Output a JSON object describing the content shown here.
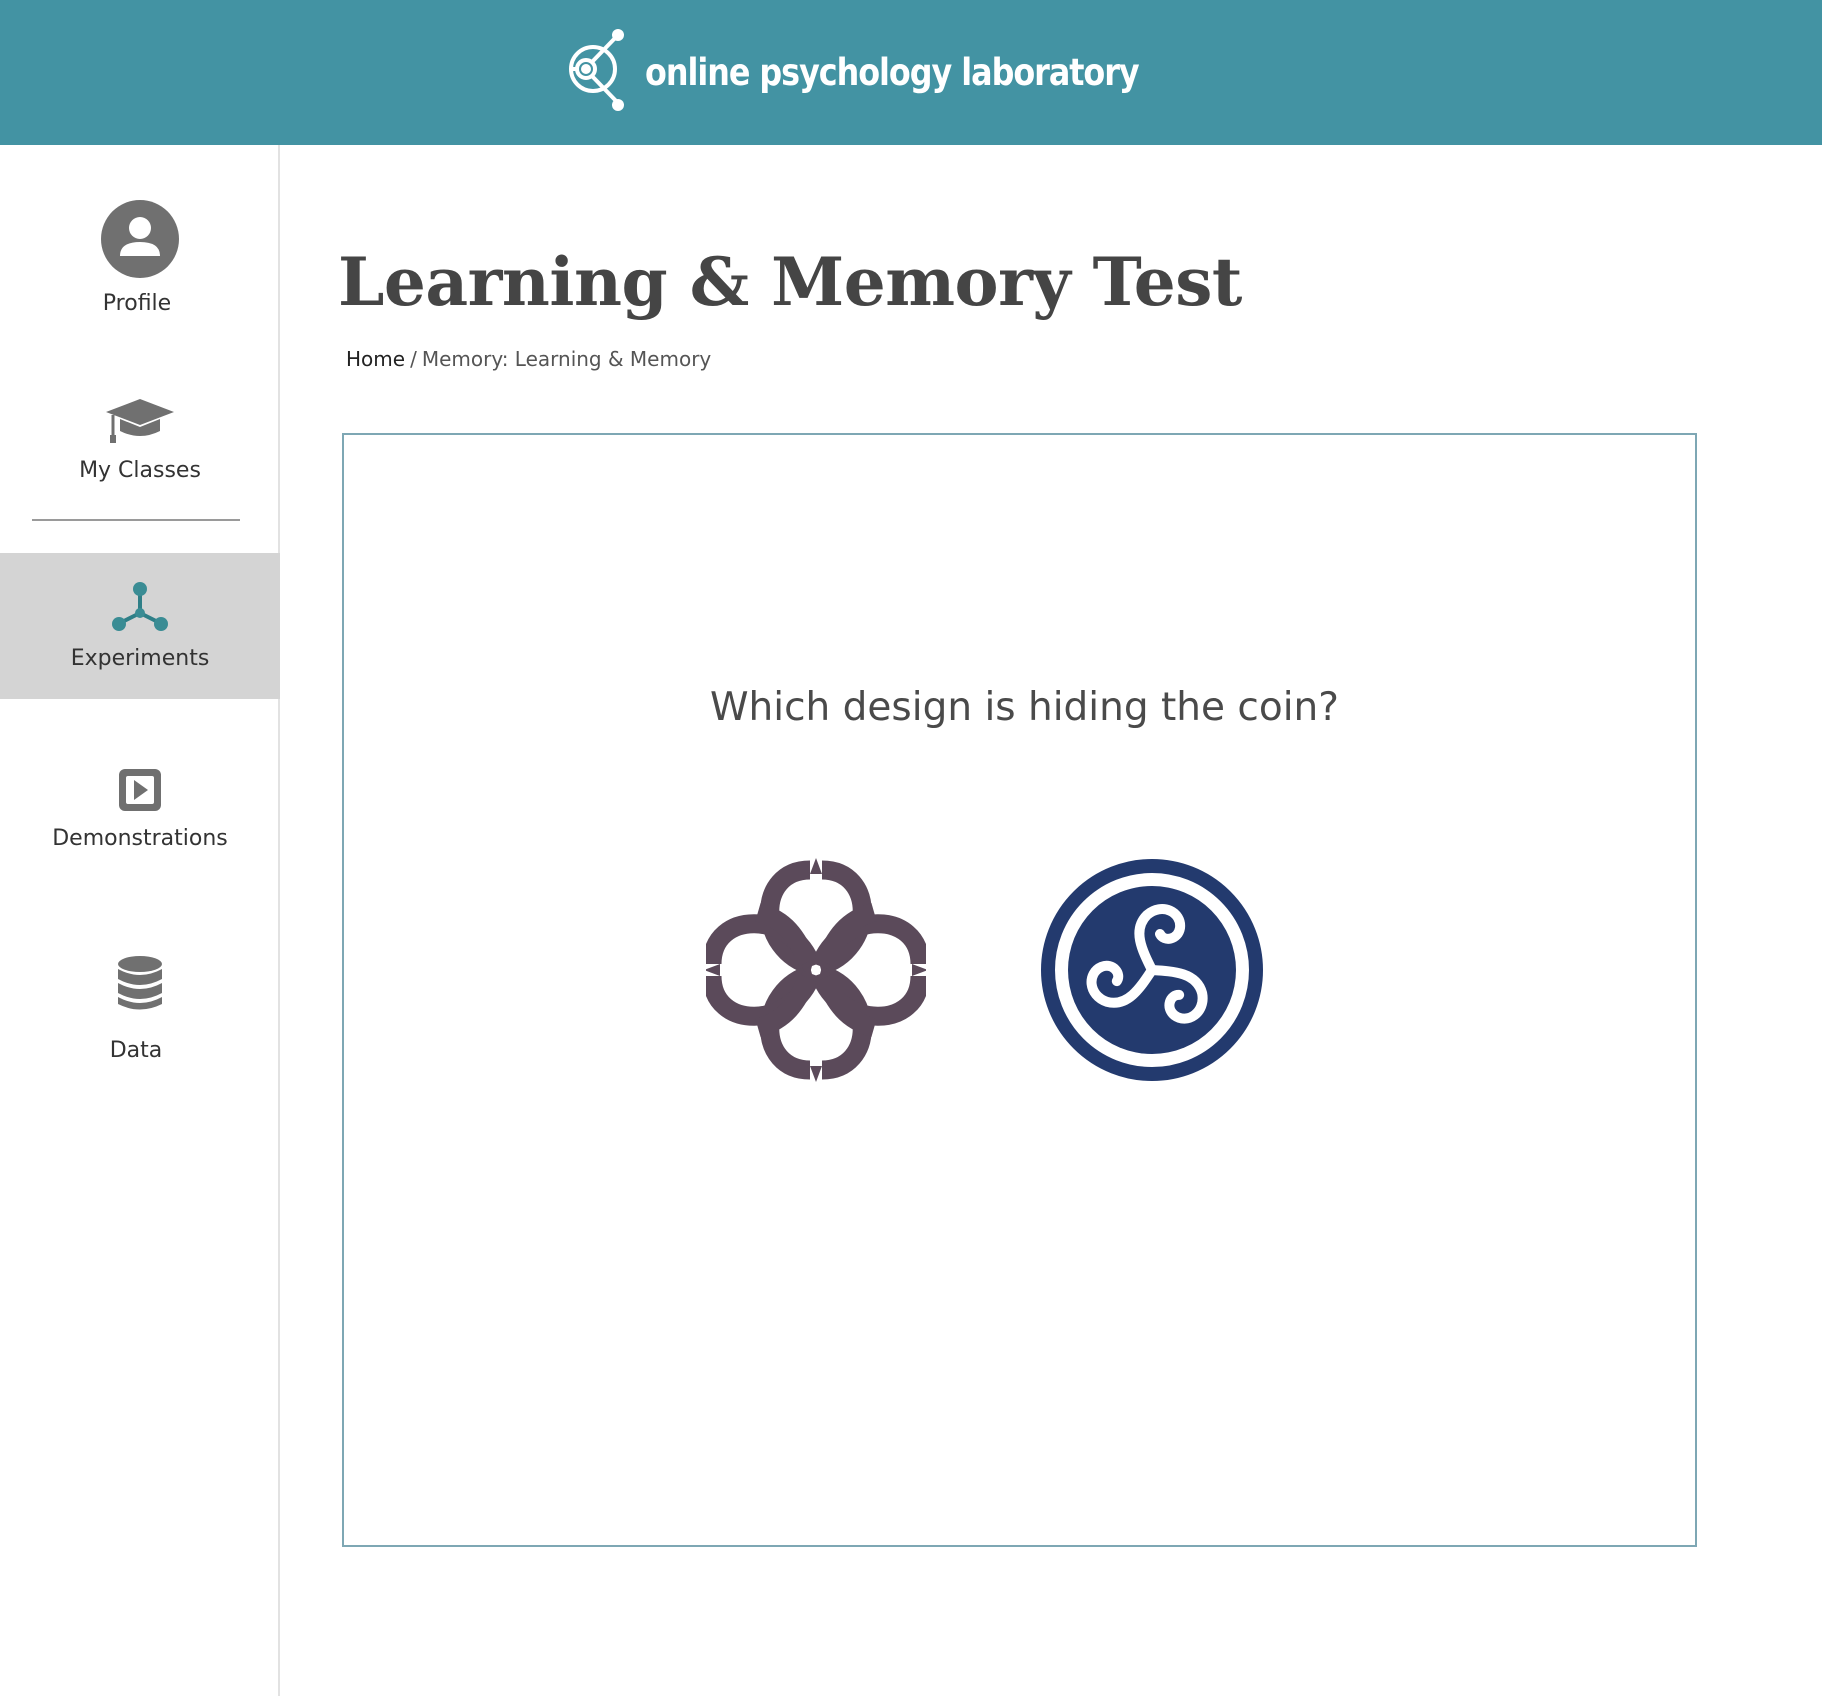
{
  "header": {
    "brand_name": "online psychology laboratory",
    "logo_icon": "atom-orbit-icon",
    "background_color": "#4393a3"
  },
  "sidebar": {
    "items": [
      {
        "label": "Profile",
        "icon": "user-circle-icon",
        "active": false
      },
      {
        "label": "My Classes",
        "icon": "graduation-cap-icon",
        "active": false
      },
      {
        "label": "Experiments",
        "icon": "molecule-icon",
        "active": true
      },
      {
        "label": "Demonstrations",
        "icon": "play-square-icon",
        "active": false
      },
      {
        "label": "Data",
        "icon": "database-icon",
        "active": false
      }
    ],
    "active_color": "#d4d4d4"
  },
  "main": {
    "title": "Learning & Memory Test",
    "breadcrumb": {
      "home": "Home",
      "separator": "/",
      "current": "Memory: Learning & Memory"
    },
    "task": {
      "question": "Which design is hiding the coin?",
      "choices": [
        {
          "design": "celtic-knot-design",
          "color": "#5b4a5a"
        },
        {
          "design": "triskele-spiral-design",
          "color": "#233a6e"
        }
      ]
    }
  }
}
